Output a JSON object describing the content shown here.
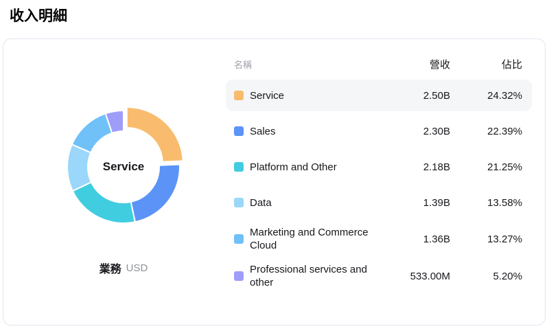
{
  "page": {
    "title": "收入明細"
  },
  "table": {
    "headers": {
      "name": "名稱",
      "revenue": "營收",
      "share": "佔比"
    }
  },
  "chart": {
    "center_label": "Service",
    "footer_label": "業務",
    "footer_unit": "USD"
  },
  "colors": {
    "row_highlight": "#f5f6f8",
    "card_border": "#e4e5f0",
    "header_text": "#9ca0a8",
    "body_text": "#17181c"
  },
  "chart_data": {
    "type": "pie",
    "title": "收入明細",
    "unit": "USD",
    "donut": true,
    "inner_radius_ratio": 0.63,
    "start_angle": "top",
    "direction": "clockwise",
    "center_label": "Service",
    "selected_label": "Service",
    "legend_position": "right-table",
    "slices": [
      {
        "label": "Service",
        "revenue": "2.50B",
        "percent": 24.32,
        "share_text": "24.32%",
        "color": "#f9bc6e",
        "selected": true
      },
      {
        "label": "Sales",
        "revenue": "2.30B",
        "percent": 22.39,
        "share_text": "22.39%",
        "color": "#5b93f7",
        "selected": false
      },
      {
        "label": "Platform and Other",
        "revenue": "2.18B",
        "percent": 21.25,
        "share_text": "21.25%",
        "color": "#41cde0",
        "selected": false
      },
      {
        "label": "Data",
        "revenue": "1.39B",
        "percent": 13.58,
        "share_text": "13.58%",
        "color": "#9ad7fa",
        "selected": false
      },
      {
        "label": "Marketing and Commerce Cloud",
        "revenue": "1.36B",
        "percent": 13.27,
        "share_text": "13.27%",
        "color": "#70c1f8",
        "selected": false
      },
      {
        "label": "Professional services and other",
        "revenue": "533.00M",
        "percent": 5.2,
        "share_text": "5.20%",
        "color": "#9e9df8",
        "selected": false
      }
    ]
  }
}
